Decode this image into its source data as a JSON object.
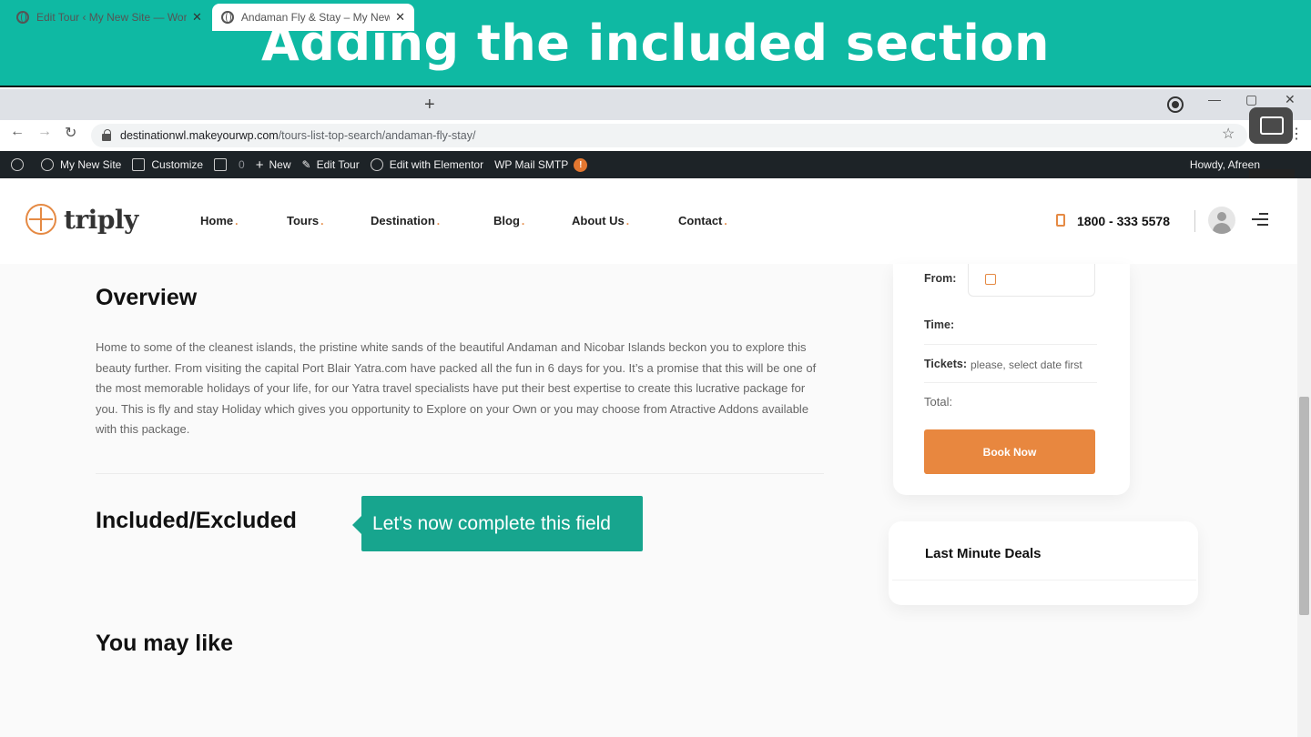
{
  "banner": {
    "title": "Adding the included section"
  },
  "browser": {
    "tabs": [
      {
        "title": "Edit Tour ‹ My New Site — WordPress",
        "active": false
      },
      {
        "title": "Andaman Fly & Stay – My New Site",
        "active": true
      }
    ],
    "new_tab": "+",
    "url_domain": "destinationwl.makeyourwp.com",
    "url_path": "/tours-list-top-search/andaman-fly-stay/",
    "window_controls": {
      "minimize": "—",
      "maximize": "▢",
      "close": "✕"
    }
  },
  "wp_admin_bar": {
    "items": [
      {
        "label": "My New Site",
        "icon": "dashboard-icon"
      },
      {
        "label": "Customize",
        "icon": "brush-icon"
      },
      {
        "label": "0",
        "icon": "comment-icon"
      },
      {
        "label": "New",
        "icon": "plus-icon"
      },
      {
        "label": "Edit Tour",
        "icon": "pencil-icon"
      },
      {
        "label": "Edit with Elementor",
        "icon": "elementor-icon"
      },
      {
        "label": "WP Mail SMTP",
        "badge": "!"
      }
    ],
    "howdy": "Howdy, Afreen"
  },
  "site": {
    "logo_text": "triply",
    "nav": [
      "Home",
      "Tours",
      "Destination",
      "Blog",
      "About Us",
      "Contact"
    ],
    "phone": "1800 - 333 5578",
    "accent_color": "#e8873f"
  },
  "main": {
    "overview_heading": "Overview",
    "overview_text": "Home to some of the cleanest islands, the pristine white sands of the beautiful Andaman and Nicobar Islands beckon you to explore this beauty further. From visiting the capital Port Blair Yatra.com have packed all the fun in 6 days for you. It’s a promise that this will be one of the most memorable holidays of your life, for our Yatra travel specialists have put their best expertise to create this lucrative package for you. This is fly and stay Holiday which gives you opportunity to Explore on your Own or you may choose from Atractive Addons available with this package.",
    "included_heading": "Included/Excluded",
    "tooltip": "Let's now complete this field",
    "tooltip_color": "#17a58e",
    "you_may_like_heading": "You may like"
  },
  "booking": {
    "from_label": "From:",
    "time_label": "Time:",
    "tickets_label": "Tickets:",
    "tickets_note": "please, select date first",
    "total_label": "Total:",
    "book_button": "Book Now"
  },
  "deals": {
    "title": "Last Minute Deals"
  }
}
